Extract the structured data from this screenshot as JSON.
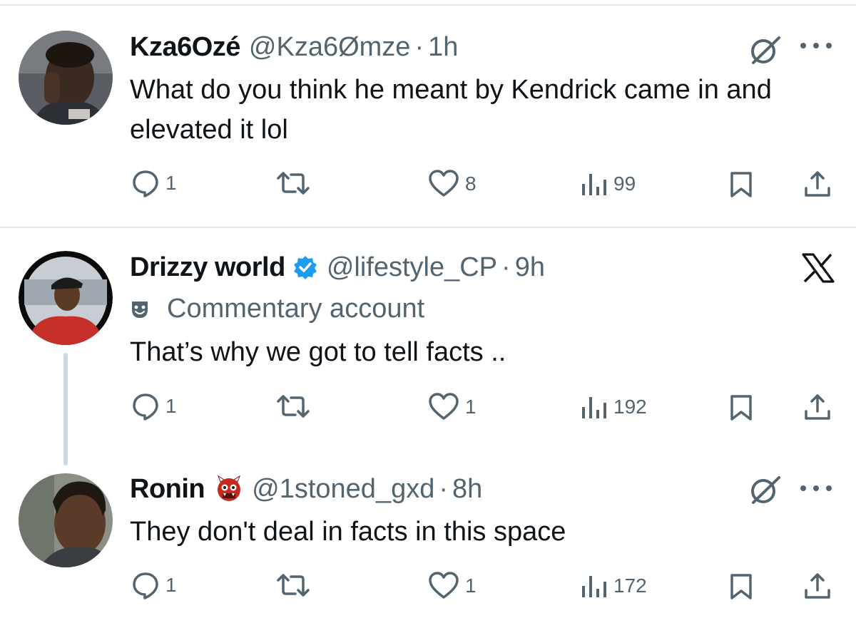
{
  "tweets": [
    {
      "name": "Kza6Ozé",
      "handle": "@Kza6Ømze",
      "time": "1h",
      "text": "What do you think he meant by Kendrick came in and elevated it lol",
      "replies": "1",
      "likes": "8",
      "views": "99",
      "top_right_icons": [
        "grok-icon",
        "more-icon"
      ]
    },
    {
      "name": "Drizzy world",
      "verified": true,
      "handle": "@lifestyle_CP",
      "time": "9h",
      "label": "Commentary account",
      "text": "That’s why we got to tell facts ..",
      "replies": "1",
      "likes": "1",
      "views": "192",
      "top_right_icons": [
        "x-logo-icon"
      ]
    },
    {
      "name": "Ronin",
      "name_emoji": "👹",
      "handle": "@1stoned_gxd",
      "time": "8h",
      "text": "They don't deal in facts in this space",
      "replies": "1",
      "likes": "1",
      "views": "172",
      "top_right_icons": [
        "grok-icon",
        "more-icon"
      ]
    }
  ],
  "separator": "·",
  "colors": {
    "text": "#0f1419",
    "secondary": "#536471",
    "verified": "#1d9bf0",
    "divider": "#e4e8eb"
  }
}
